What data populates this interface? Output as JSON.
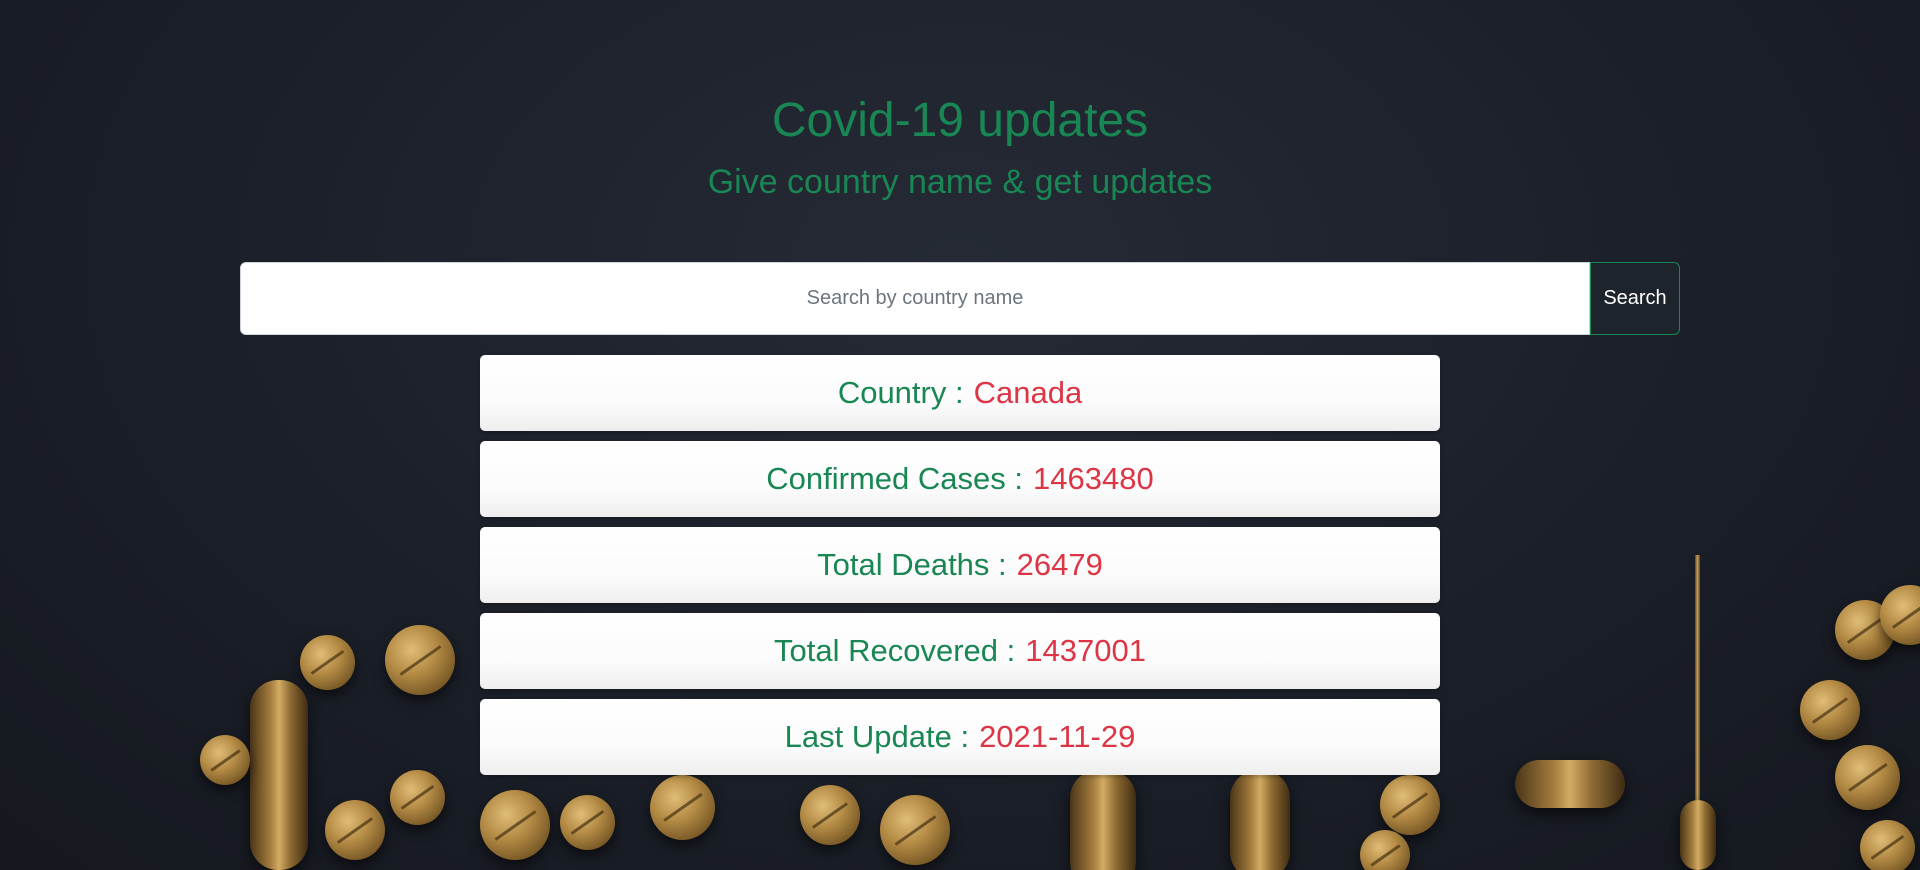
{
  "header": {
    "title": "Covid-19 updates",
    "subtitle": "Give country name & get updates"
  },
  "search": {
    "placeholder": "Search by country name",
    "value": "",
    "button_label": "Search"
  },
  "results": [
    {
      "label": "Country :",
      "value": "Canada"
    },
    {
      "label": "Confirmed Cases :",
      "value": "1463480"
    },
    {
      "label": "Total Deaths :",
      "value": "26479"
    },
    {
      "label": "Total Recovered :",
      "value": "1437001"
    },
    {
      "label": "Last Update :",
      "value": "2021-11-29"
    }
  ],
  "colors": {
    "heading": "#198754",
    "value": "#dc3545",
    "background": "#1b1f28",
    "card": "#ffffff"
  }
}
